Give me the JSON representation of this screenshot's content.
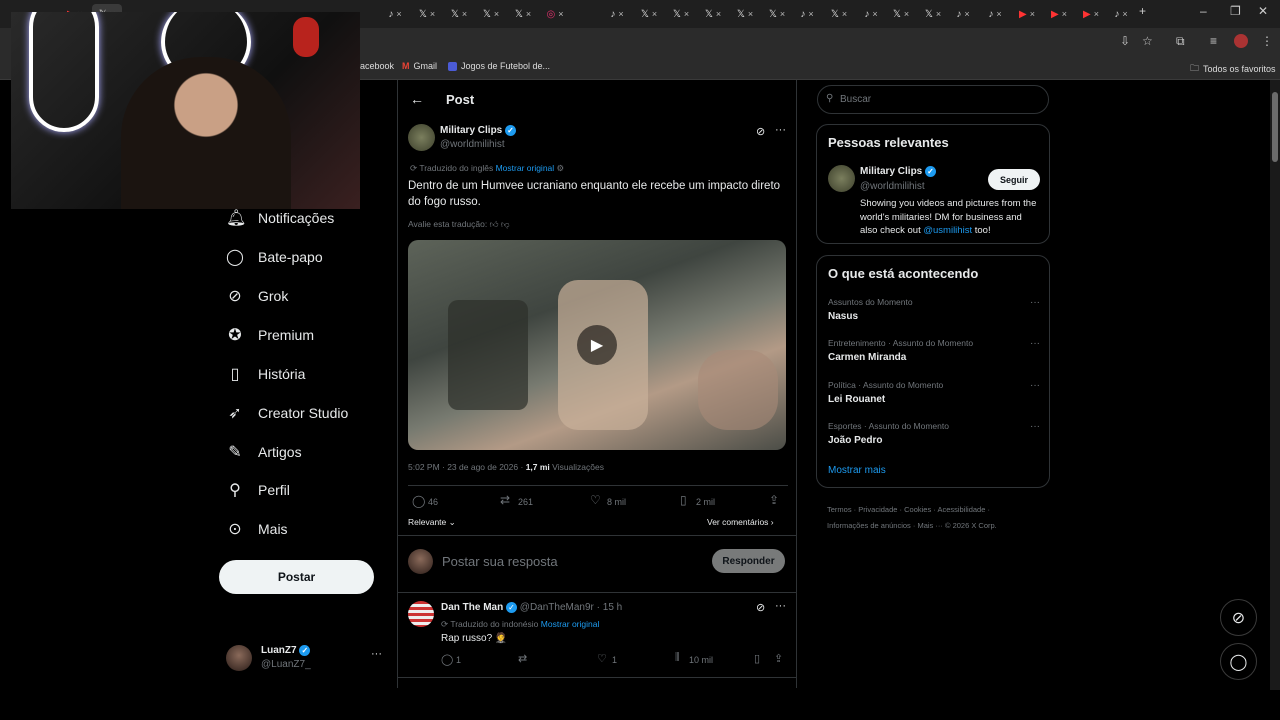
{
  "browser": {
    "bookmarks": [
      {
        "label": "acebook",
        "icon": "facebook-icon"
      },
      {
        "label": "Gmail",
        "icon": "gmail-icon"
      },
      {
        "label": "Jogos de Futebol de...",
        "icon": "game-icon"
      }
    ],
    "all_bookmarks": "Todos os favoritos"
  },
  "nav": {
    "items": [
      {
        "label": "Notificações",
        "icon": "bell-icon"
      },
      {
        "label": "Bate-papo",
        "icon": "chat-icon"
      },
      {
        "label": "Grok",
        "icon": "grok-icon"
      },
      {
        "label": "Premium",
        "icon": "verified-icon"
      },
      {
        "label": "História",
        "icon": "bookmark-icon"
      },
      {
        "label": "Creator Studio",
        "icon": "rocket-icon"
      },
      {
        "label": "Artigos",
        "icon": "article-icon"
      },
      {
        "label": "Perfil",
        "icon": "person-icon"
      },
      {
        "label": "Mais",
        "icon": "more-circle-icon"
      }
    ],
    "post_button": "Postar",
    "me": {
      "name": "LuanZ7",
      "handle": "@LuanZ7_"
    }
  },
  "post": {
    "header": "Post",
    "author": "Military Clips",
    "handle": "@worldmilihist",
    "translated_from": "Traduzido do inglês",
    "show_original": "Mostrar original",
    "text": "Dentro de um Humvee ucraniano enquanto ele recebe um impacto direto do fogo russo.",
    "rate_translation": "Avalie esta tradução:",
    "time": "5:02 PM · 23 de ago de 2026 ·",
    "views_count": "1,7 mi",
    "views_label": "Visualizações",
    "replies": "46",
    "reposts": "261",
    "likes": "8 mil",
    "bookmarks": "2 mil",
    "sort": "Relevante",
    "see_comments": "Ver comentários",
    "reply_placeholder": "Postar sua resposta",
    "reply_button": "Responder"
  },
  "reply": {
    "author": "Dan The Man",
    "handle": "@DanTheMan9r · 15 h",
    "translated_from": "Traduzido do indonésio",
    "show_original": "Mostrar original",
    "text": "Rap russo? 🤵",
    "replies": "1",
    "likes": "1",
    "views": "10 mil"
  },
  "sidebar": {
    "search_placeholder": "Buscar",
    "relevant_title": "Pessoas relevantes",
    "relevant_name": "Military Clips",
    "relevant_handle": "@worldmilihist",
    "follow": "Seguir",
    "bio": "Showing you videos and pictures from the world's militaries! DM for business and also check out",
    "bio_link": "@usmilihist",
    "bio_end": "too!",
    "trends_title": "O que está acontecendo",
    "trends": [
      {
        "category": "Assuntos do Momento",
        "name": "Nasus"
      },
      {
        "category": "Entretenimento · Assunto do Momento",
        "name": "Carmen Miranda"
      },
      {
        "category": "Política · Assunto do Momento",
        "name": "Lei Rouanet"
      },
      {
        "category": "Esportes · Assunto do Momento",
        "name": "João Pedro"
      }
    ],
    "show_more": "Mostrar mais",
    "footer_line1": "Termos · Privacidade · Cookies · Acessibilidade ·",
    "footer_line2": "Informações de anúncios · Mais ··· © 2026 X Corp."
  }
}
